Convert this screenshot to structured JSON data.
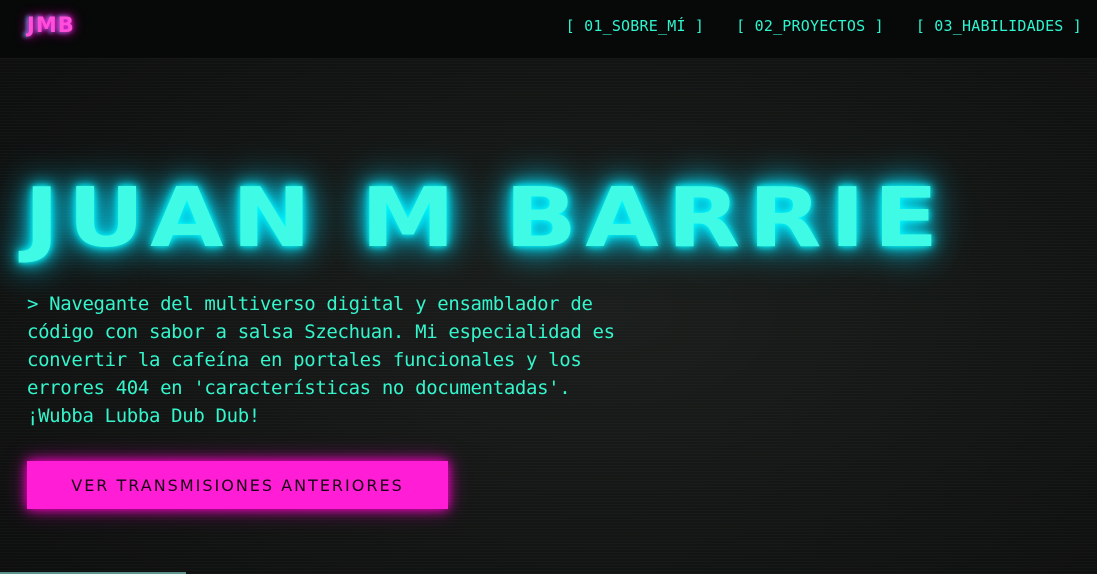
{
  "header": {
    "logo": "JMB",
    "nav": [
      {
        "label": "[ 01_SOBRE_MÍ ]"
      },
      {
        "label": "[ 02_PROYECTOS ]"
      },
      {
        "label": "[ 03_HABILIDADES ]"
      }
    ]
  },
  "hero": {
    "title": "JUAN M BARRIE",
    "description": [
      "> Navegante del multiverso digital y ensamblador de",
      "código con sabor a salsa Szechuan. Mi especialidad es",
      "convertir la cafeína en portales funcionales y los",
      "errores 404 en 'características no documentadas'.",
      "¡Wubba Lubba Dub Dub!"
    ],
    "cta_label": "VER TRANSMISIONES ANTERIORES"
  },
  "colors": {
    "accent_cyan": "#34f5cb",
    "accent_magenta": "#ff1ed6",
    "background": "#121413"
  }
}
